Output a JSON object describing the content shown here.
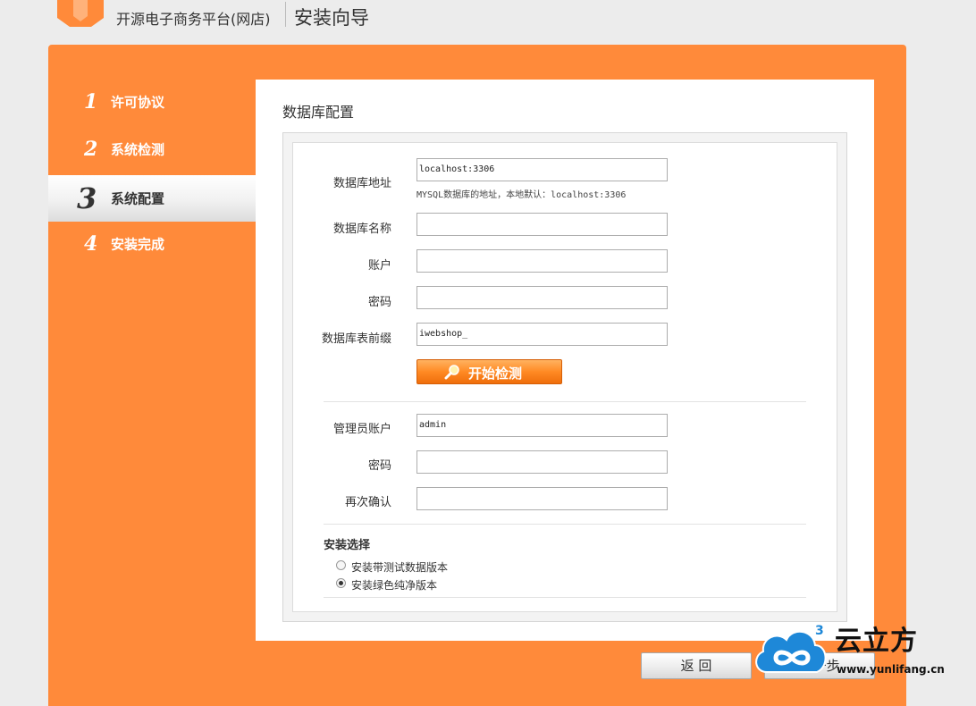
{
  "header": {
    "brand": "开源电子商务平台(网店)",
    "title": "安装向导"
  },
  "steps": [
    {
      "num": "1",
      "label": "许可协议",
      "active": false
    },
    {
      "num": "2",
      "label": "系统检测",
      "active": false
    },
    {
      "num": "3",
      "label": "系统配置",
      "active": true
    },
    {
      "num": "4",
      "label": "安装完成",
      "active": false
    }
  ],
  "panel": {
    "title": "数据库配置"
  },
  "db": {
    "host_label": "数据库地址",
    "host_value": "localhost:3306",
    "host_hint": "MYSQL数据库的地址，本地默认：localhost:3306",
    "name_label": "数据库名称",
    "name_value": "",
    "user_label": "账户",
    "user_value": "",
    "pass_label": "密码",
    "pass_value": "",
    "prefix_label": "数据库表前缀",
    "prefix_value": "iwebshop_",
    "check_button": "开始检测"
  },
  "admin": {
    "user_label": "管理员账户",
    "user_value": "admin",
    "pass_label": "密码",
    "pass_value": "",
    "confirm_label": "再次确认",
    "confirm_value": ""
  },
  "install": {
    "section_title": "安装选择",
    "options": [
      {
        "label": "安装带测试数据版本",
        "checked": false
      },
      {
        "label": "安装绿色纯净版本",
        "checked": true
      }
    ]
  },
  "footer": {
    "back_label": "返 回",
    "next_label": "下一步"
  },
  "watermark": {
    "text": "云立方",
    "url": "www.yunlifang.cn",
    "badge": "3"
  },
  "colors": {
    "accent": "#ff8a3a",
    "button_orange": "#ff8a24"
  }
}
